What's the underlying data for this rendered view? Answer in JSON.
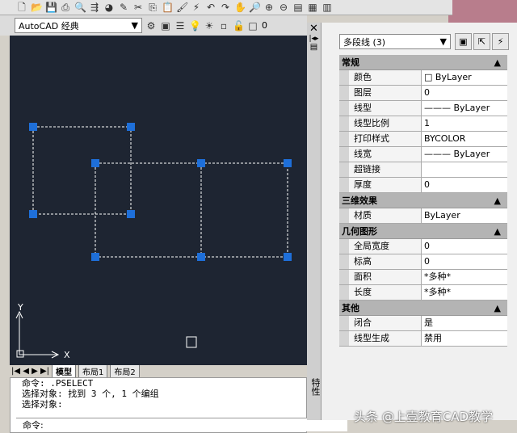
{
  "workspace": {
    "selected": "AutoCAD 经典",
    "layer": "0"
  },
  "layout_tabs": [
    "模型",
    "布局1",
    "布局2"
  ],
  "command": {
    "lines": [
      "命令:  .PSELECT",
      "选择对象: 找到 3 个, 1 个编组",
      "选择对象:"
    ],
    "prompt": "命令:"
  },
  "palette": {
    "side_label": "特性",
    "selection": "多段线 (3)",
    "sections": [
      {
        "title": "常规",
        "rows": [
          [
            "颜色",
            "□ ByLayer"
          ],
          [
            "图层",
            "0"
          ],
          [
            "线型",
            "——— ByLayer"
          ],
          [
            "线型比例",
            "1"
          ],
          [
            "打印样式",
            "BYCOLOR"
          ],
          [
            "线宽",
            "——— ByLayer"
          ],
          [
            "超链接",
            ""
          ],
          [
            "厚度",
            "0"
          ]
        ]
      },
      {
        "title": "三维效果",
        "rows": [
          [
            "材质",
            "ByLayer"
          ]
        ]
      },
      {
        "title": "几何图形",
        "rows": [
          [
            "全局宽度",
            "0"
          ],
          [
            "标高",
            "0"
          ],
          [
            "面积",
            "*多种*"
          ],
          [
            "长度",
            "*多种*"
          ]
        ]
      },
      {
        "title": "其他",
        "rows": [
          [
            "闭合",
            "是"
          ],
          [
            "线型生成",
            "禁用"
          ]
        ]
      }
    ]
  },
  "ucs": {
    "x": "X",
    "y": "Y"
  },
  "watermark": "头条 @上壹教育CAD教学",
  "colors": {
    "canvas": "#1e2532",
    "grip": "#1e6fd9"
  }
}
